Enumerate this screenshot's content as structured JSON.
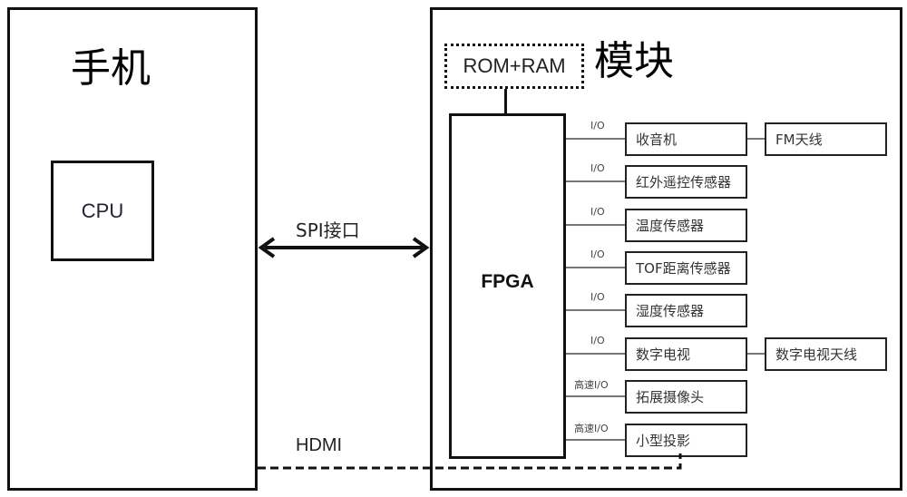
{
  "phone": {
    "title": "手机",
    "cpu_label": "CPU"
  },
  "links": {
    "spi_label": "SPI接口",
    "hdmi_label": "HDMI"
  },
  "module": {
    "title": "模块",
    "memory_label": "ROM+RAM",
    "fpga_label": "FPGA",
    "peripherals": [
      {
        "interface": "I/O",
        "label": "收音机",
        "antenna": "FM天线"
      },
      {
        "interface": "I/O",
        "label": "红外遥控传感器",
        "antenna": null
      },
      {
        "interface": "I/O",
        "label": "温度传感器",
        "antenna": null
      },
      {
        "interface": "I/O",
        "label": "TOF距离传感器",
        "antenna": null
      },
      {
        "interface": "I/O",
        "label": "湿度传感器",
        "antenna": null
      },
      {
        "interface": "I/O",
        "label": "数字电视",
        "antenna": "数字电视天线"
      },
      {
        "interface": "高速I/O",
        "label": "拓展摄像头",
        "antenna": null
      },
      {
        "interface": "高速I/O",
        "label": "小型投影",
        "antenna": null
      }
    ]
  }
}
